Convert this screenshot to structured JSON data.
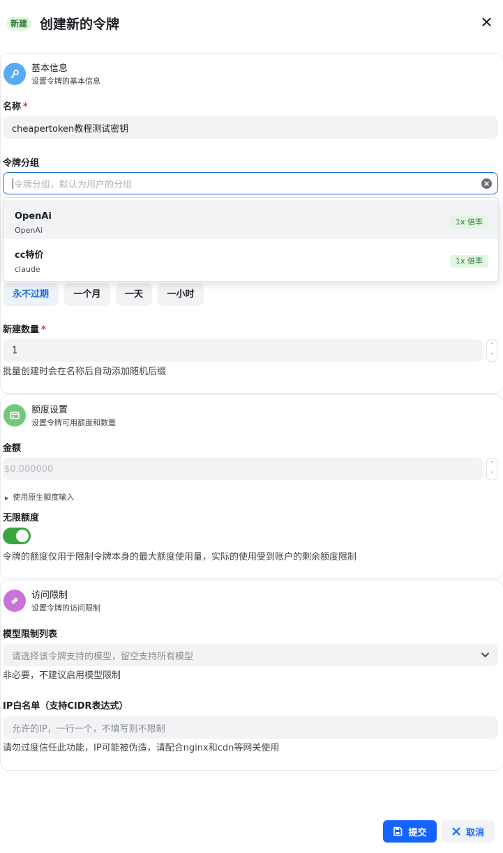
{
  "header": {
    "badge": "新建",
    "title": "创建新的令牌"
  },
  "basic": {
    "title": "基本信息",
    "subtitle": "设置令牌的基本信息",
    "name_label": "名称",
    "name_value": "cheapertoken教程测试密钥",
    "group_label": "令牌分组",
    "group_placeholder": "令牌分组，默认为用户的分组",
    "group_options": [
      {
        "name": "OpenAi",
        "desc": "OpenAi",
        "tag": "1x 倍率"
      },
      {
        "name": "cc特价",
        "desc": "claude",
        "tag": "1x 倍率"
      }
    ],
    "expire_options": [
      "永不过期",
      "一个月",
      "一天",
      "一小时"
    ],
    "count_label": "新建数量",
    "count_value": "1",
    "count_hint": "批量创建时会在名称后自动添加随机后缀"
  },
  "quota": {
    "title": "额度设置",
    "subtitle": "设置令牌可用额度和数量",
    "amount_label": "金额",
    "amount_placeholder": "$0.000000",
    "native_toggle": "使用原生额度输入",
    "unlimited_label": "无限额度",
    "unlimited_on": true,
    "unlimited_hint": "令牌的额度仅用于限制令牌本身的最大额度使用量，实际的使用受到账户的剩余额度限制"
  },
  "access": {
    "title": "访问限制",
    "subtitle": "设置令牌的访问限制",
    "models_label": "模型限制列表",
    "models_placeholder": "请选择该令牌支持的模型，留空支持所有模型",
    "models_hint": "非必要，不建议启用模型限制",
    "ip_label": "IP白名单（支持CIDR表达式）",
    "ip_placeholder": "允许的IP，一行一个，不填写则不限制",
    "ip_hint": "请勿过度信任此功能，IP可能被伪造，请配合nginx和cdn等网关使用"
  },
  "footer": {
    "submit": "提交",
    "cancel": "取消"
  },
  "colors": {
    "primary": "#1664ff",
    "success": "#3aa53f",
    "basic_icon": "#5aa9f5",
    "quota_icon": "#72c97a",
    "access_icon": "#c774d6"
  }
}
